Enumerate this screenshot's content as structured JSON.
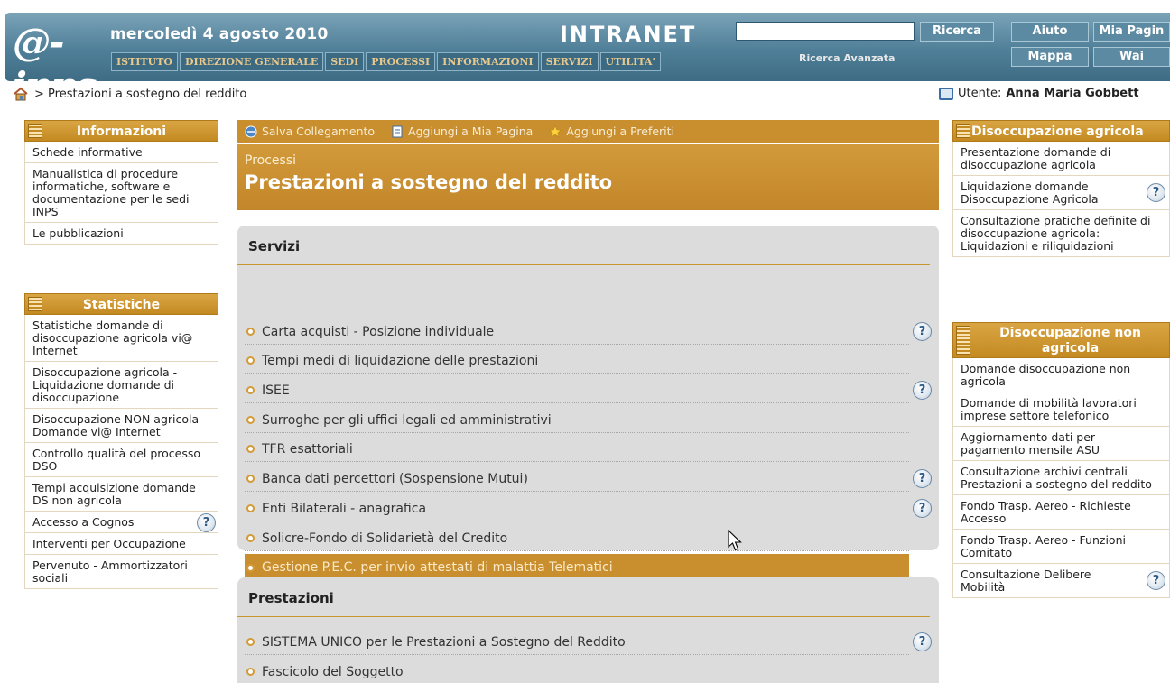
{
  "header": {
    "date": "mercoledì 4 agosto 2010",
    "logo_text": "@-inps",
    "title": "INTRANET",
    "nav": [
      "ISTITUTO",
      "DIREZIONE GENERALE",
      "SEDI",
      "PROCESSI",
      "INFORMAZIONI",
      "SERVIZI",
      "UTILITA'"
    ],
    "search_value": "",
    "search_button": "Ricerca",
    "advanced_search": "Ricerca Avanzata",
    "help_button": "Aiuto",
    "my_page_button": "Mia Pagin",
    "map_button": "Mappa",
    "wai_button": "Wai"
  },
  "breadcrumb": {
    "text": "> Prestazioni a sostegno del reddito"
  },
  "user": {
    "label": "Utente:",
    "name": "Anna Maria Gobbett"
  },
  "left": {
    "info": {
      "title": "Informazioni",
      "items": [
        "Schede informative",
        "Manualistica di procedure informatiche, software e documentazione per le sedi INPS",
        "Le pubblicazioni"
      ]
    },
    "stats": {
      "title": "Statistiche",
      "items": [
        "Statistiche domande di disoccupazione agricola vi@ Internet",
        "Disoccupazione agricola - Liquidazione domande di disoccupazione",
        "Disoccupazione NON agricola - Domande vi@ Internet",
        "Controllo qualità del processo DSO",
        "Tempi acquisizione domande DS non agricola",
        "Accesso a Cognos",
        "Interventi per Occupazione",
        "Pervenuto - Ammortizzatori sociali"
      ]
    }
  },
  "toolbar": {
    "save_link": "Salva Collegamento",
    "add_page": "Aggiungi a Mia Pagina",
    "add_fav": "Aggiungi a Preferiti"
  },
  "main": {
    "section_small": "Processi",
    "section_title": "Prestazioni a sostegno del reddito",
    "servizi_title": "Servizi",
    "servizi": [
      "Carta acquisti - Posizione individuale",
      "Tempi medi di liquidazione delle prestazioni",
      "ISEE",
      "Surroghe per gli uffici legali ed amministrativi",
      "TFR esattoriali",
      "Banca dati percettori (Sospensione Mutui)",
      "Enti Bilaterali - anagrafica",
      "Solicre-Fondo di Solidarietà del Credito",
      "Gestione P.E.C. per invio attestati di malattia Telematici"
    ],
    "prestazioni_title": "Prestazioni",
    "prestazioni": [
      "SISTEMA UNICO per le Prestazioni a Sostegno del Reddito",
      "Fascicolo del Soggetto"
    ]
  },
  "right": {
    "agricola": {
      "title": "Disoccupazione agricola",
      "items": [
        "Presentazione domande di disoccupazione agricola",
        "Liquidazione domande Disoccupazione Agricola",
        "Consultazione pratiche definite di disoccupazione agricola: Liquidazioni e riliquidazioni"
      ]
    },
    "non_agricola": {
      "title": "Disoccupazione non agricola",
      "items": [
        "Domande disoccupazione non agricola",
        "Domande di mobilità lavoratori imprese settore telefonico",
        "Aggiornamento dati per pagamento mensile ASU",
        "Consultazione archivi centrali Prestazioni a sostegno del reddito",
        "Fondo Trasp. Aereo - Richieste Accesso",
        "Fondo Trasp. Aereo - Funzioni Comitato",
        "Consultazione Delibere Mobilità"
      ]
    }
  },
  "help_glyph": "?"
}
